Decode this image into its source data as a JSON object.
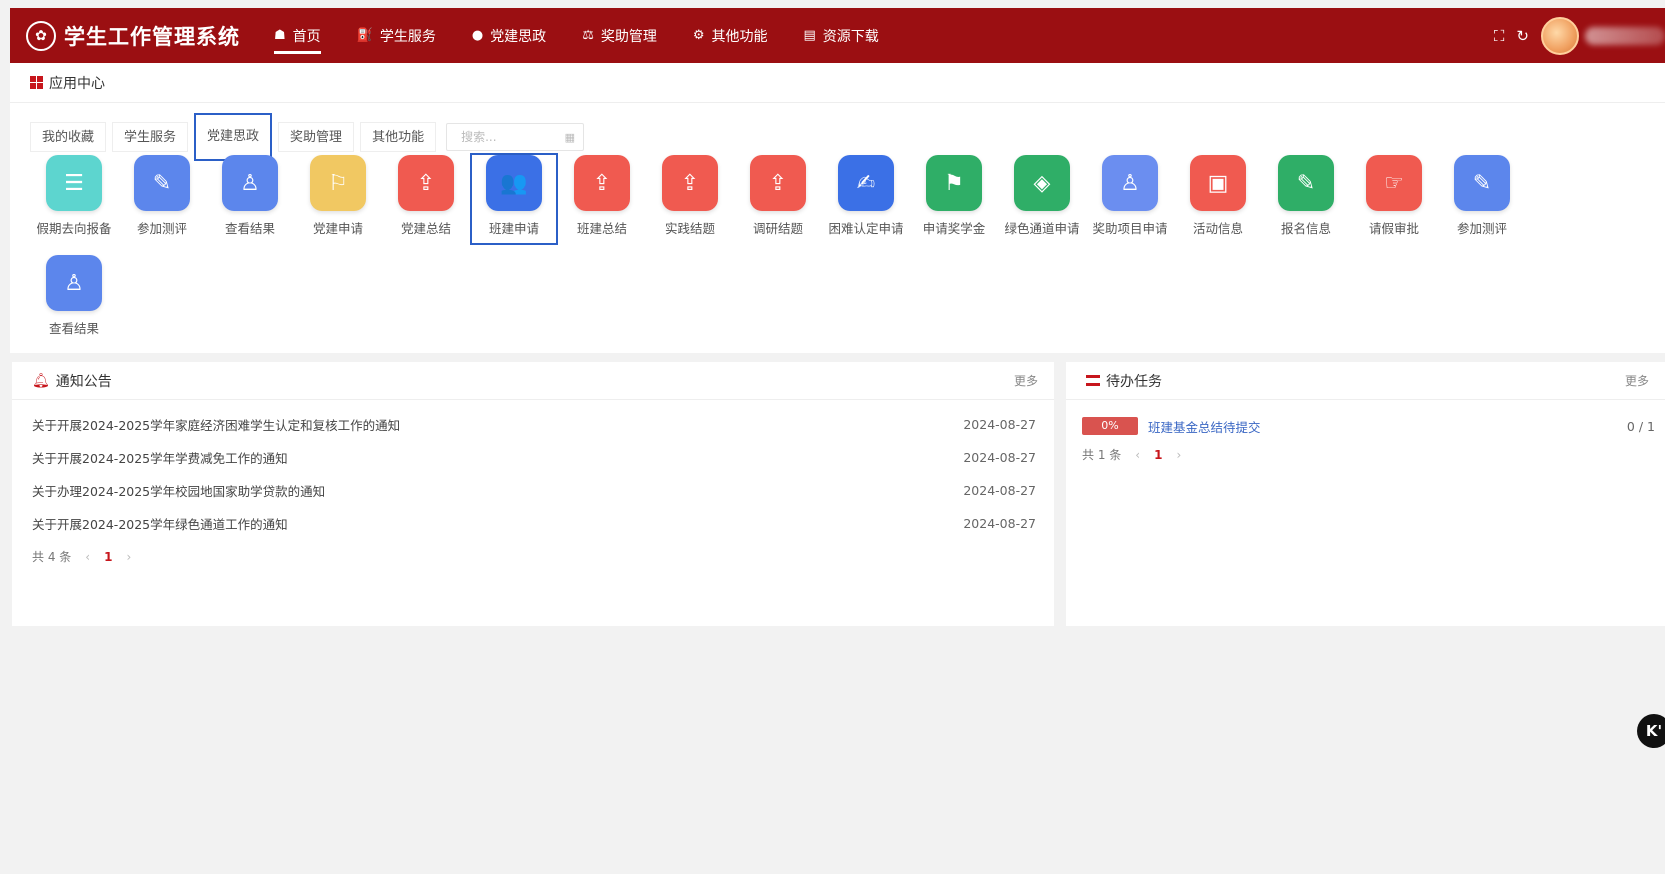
{
  "header": {
    "title": "学生工作管理系统",
    "nav": [
      {
        "label": "首页",
        "icon": "home-icon",
        "glyph": "☗",
        "active": true
      },
      {
        "label": "学生服务",
        "icon": "graduation-cap-icon",
        "glyph": "⛽",
        "active": false
      },
      {
        "label": "党建思政",
        "icon": "info-circle-icon",
        "glyph": "●",
        "active": false
      },
      {
        "label": "奖助管理",
        "icon": "scale-icon",
        "glyph": "⚖",
        "active": false
      },
      {
        "label": "其他功能",
        "icon": "bicycle-icon",
        "glyph": "⚙",
        "active": false
      },
      {
        "label": "资源下载",
        "icon": "file-icon",
        "glyph": "▤",
        "active": false
      }
    ]
  },
  "app_center": {
    "title": "应用中心",
    "tabs": [
      "我的收藏",
      "学生服务",
      "党建思政",
      "奖助管理",
      "其他功能"
    ],
    "active_tab": "党建思政",
    "search_placeholder": "搜索...",
    "apps": [
      {
        "label": "假期去向报备",
        "icon": "list-icon",
        "glyph": "☰",
        "color": "#5dd5cf"
      },
      {
        "label": "参加测评",
        "icon": "pencil-icon",
        "glyph": "✎",
        "color": "#5c86ec"
      },
      {
        "label": "查看结果",
        "icon": "person-icon",
        "glyph": "♙",
        "color": "#5c86ec"
      },
      {
        "label": "党建申请",
        "icon": "flag-outline-icon",
        "glyph": "⚐",
        "color": "#f1c862"
      },
      {
        "label": "党建总结",
        "icon": "upload-icon",
        "glyph": "⇪",
        "color": "#f05a50"
      },
      {
        "label": "班建申请",
        "icon": "group-icon",
        "glyph": "👥",
        "color": "#3b70e6",
        "selected": true
      },
      {
        "label": "班建总结",
        "icon": "upload-icon",
        "glyph": "⇪",
        "color": "#f05a50"
      },
      {
        "label": "实践结题",
        "icon": "upload-icon",
        "glyph": "⇪",
        "color": "#f05a50"
      },
      {
        "label": "调研结题",
        "icon": "upload-icon",
        "glyph": "⇪",
        "color": "#f05a50"
      },
      {
        "label": "困难认定申请",
        "icon": "edit-icon",
        "glyph": "✍",
        "color": "#3b70e6"
      },
      {
        "label": "申请奖学金",
        "icon": "flag-icon",
        "glyph": "⚑",
        "color": "#2fae67"
      },
      {
        "label": "绿色通道申请",
        "icon": "compass-icon",
        "glyph": "◈",
        "color": "#2fae67"
      },
      {
        "label": "奖助项目申请",
        "icon": "person-icon",
        "glyph": "♙",
        "color": "#6b8ef0"
      },
      {
        "label": "活动信息",
        "icon": "id-card-icon",
        "glyph": "▣",
        "color": "#f05a50"
      },
      {
        "label": "报名信息",
        "icon": "edit-square-icon",
        "glyph": "✎",
        "color": "#2fae67"
      },
      {
        "label": "请假审批",
        "icon": "hand-pointer-icon",
        "glyph": "☞",
        "color": "#f05a50"
      },
      {
        "label": "参加测评",
        "icon": "pencil-icon",
        "glyph": "✎",
        "color": "#5c86ec"
      },
      {
        "label": "查看结果",
        "icon": "person-icon",
        "glyph": "♙",
        "color": "#5c86ec"
      }
    ]
  },
  "notices": {
    "title": "通知公告",
    "more": "更多",
    "items": [
      {
        "title": "关于开展2024-2025学年家庭经济困难学生认定和复核工作的通知",
        "date": "2024-08-27"
      },
      {
        "title": "关于开展2024-2025学年学费减免工作的通知",
        "date": "2024-08-27"
      },
      {
        "title": "关于办理2024-2025学年校园地国家助学贷款的通知",
        "date": "2024-08-27"
      },
      {
        "title": "关于开展2024-2025学年绿色通道工作的通知",
        "date": "2024-08-27"
      }
    ],
    "total": "共 4 条",
    "page": "1"
  },
  "todo": {
    "title": "待办任务",
    "more": "更多",
    "items": [
      {
        "progress": "0%",
        "title": "班建基金总结待提交",
        "count": "0 / 1"
      }
    ],
    "total": "共 1 条",
    "page": "1"
  },
  "fab": {
    "label": "K'"
  }
}
